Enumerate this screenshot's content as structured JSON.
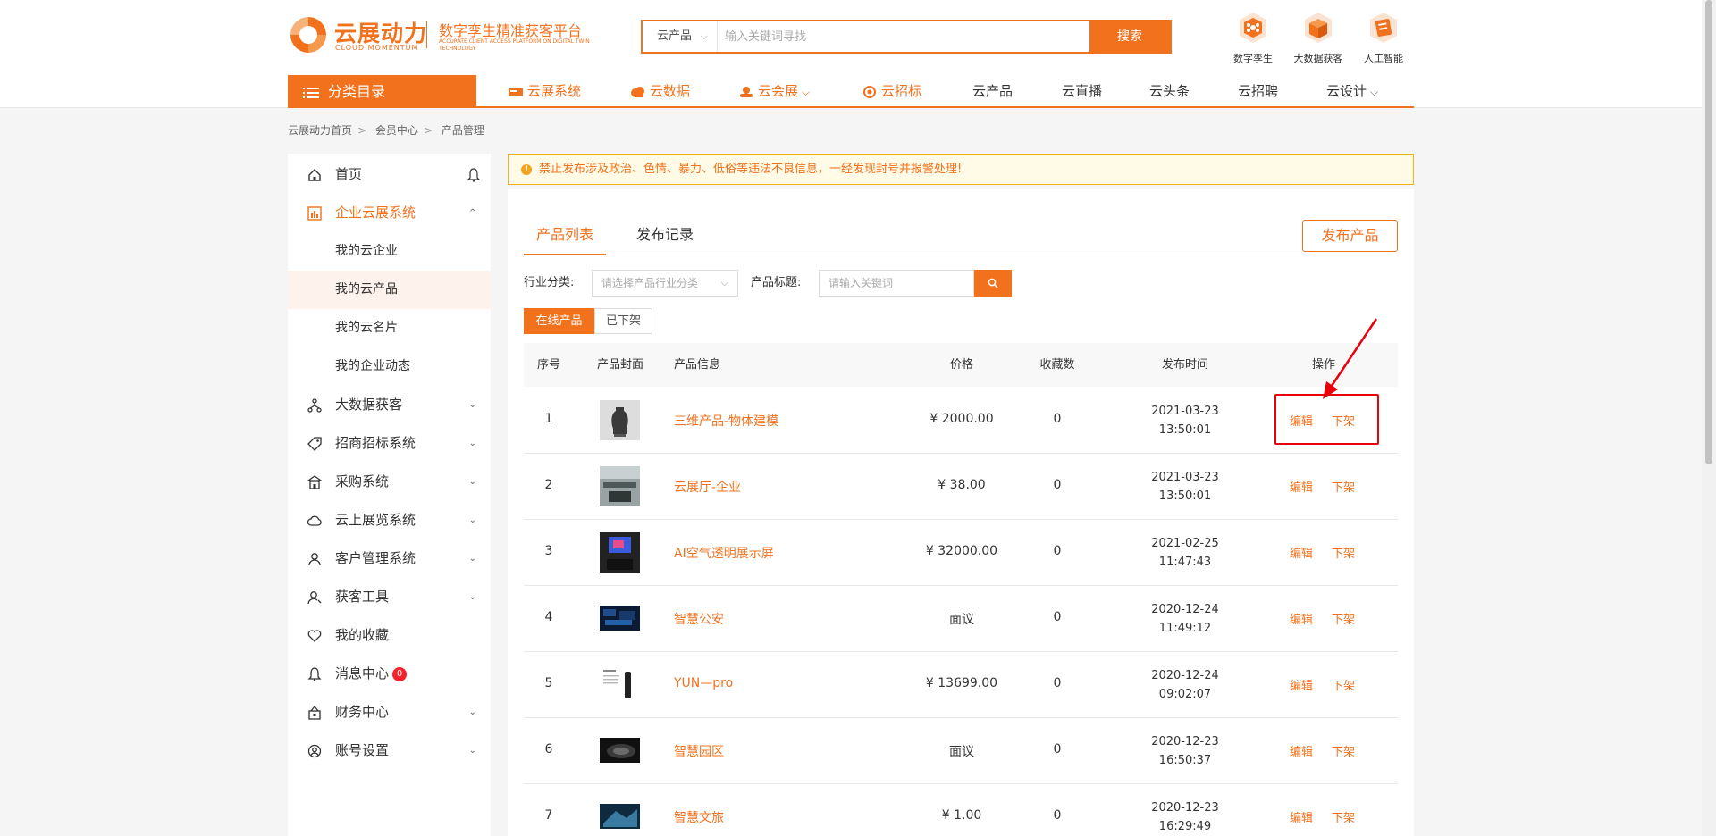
{
  "brand": {
    "name": "云展动力",
    "name_en": "CLOUD MOMENTUM",
    "slogan": "数字孪生精准获客平台",
    "slogan_en": "ACCURATE CLIENT ACCESS PLATFORM ON DIGITAL TWIN TECHNOLOGY",
    "color": "#f2711c"
  },
  "search": {
    "category": "云产品",
    "placeholder": "输入关键词寻找",
    "button": "搜索"
  },
  "quick_links": [
    {
      "label": "数字孪生",
      "icon": "digital-twin-icon"
    },
    {
      "label": "大数据获客",
      "icon": "big-data-icon"
    },
    {
      "label": "人工智能",
      "icon": "ai-icon"
    }
  ],
  "nav": {
    "category_label": "分类目录",
    "items": [
      {
        "label": "云展系统",
        "icon": "exhibition-icon"
      },
      {
        "label": "云数据",
        "icon": "cloud-data-icon"
      },
      {
        "label": "云会展",
        "icon": "convention-icon"
      },
      {
        "label": "云招标",
        "icon": "tender-icon"
      },
      {
        "label": "云产品"
      },
      {
        "label": "云直播"
      },
      {
        "label": "云头条"
      },
      {
        "label": "云招聘"
      },
      {
        "label": "云设计"
      }
    ]
  },
  "breadcrumb": [
    "云展动力首页",
    "会员中心",
    "产品管理"
  ],
  "sidebar": {
    "items": [
      {
        "label": "首页",
        "icon": "home-icon"
      },
      {
        "label": "企业云展系统",
        "icon": "enterprise-icon"
      },
      {
        "label": "大数据获客",
        "icon": "network-icon"
      },
      {
        "label": "招商招标系统",
        "icon": "tag-icon"
      },
      {
        "label": "采购系统",
        "icon": "store-icon"
      },
      {
        "label": "云上展览系统",
        "icon": "cloud-icon"
      },
      {
        "label": "客户管理系统",
        "icon": "user-icon"
      },
      {
        "label": "获客工具",
        "icon": "user-tool-icon"
      },
      {
        "label": "我的收藏",
        "icon": "heart-icon"
      },
      {
        "label": "消息中心",
        "icon": "bell-icon",
        "badge": "0"
      },
      {
        "label": "财务中心",
        "icon": "finance-icon"
      },
      {
        "label": "账号设置",
        "icon": "account-icon"
      }
    ],
    "sub_items": [
      "我的云企业",
      "我的云产品",
      "我的云名片",
      "我的企业动态"
    ]
  },
  "notice": "禁止发布涉及政治、色情、暴力、低俗等违法不良信息，一经发现封号并报警处理!",
  "tabs": [
    "产品列表",
    "发布记录"
  ],
  "publish_button": "发布产品",
  "filters": {
    "industry_label": "行业分类:",
    "industry_placeholder": "请选择产品行业分类",
    "title_label": "产品标题:",
    "title_placeholder": "请输入关键词"
  },
  "status_toggle": [
    "在线产品",
    "已下架"
  ],
  "table": {
    "headers": [
      "序号",
      "产品封面",
      "产品信息",
      "价格",
      "收藏数",
      "发布时间",
      "操作"
    ],
    "rows": [
      {
        "no": "1",
        "name": "三维产品-物体建模",
        "price": "¥ 2000.00",
        "fav": "0",
        "date": "2021-03-23",
        "time": "13:50:01",
        "edit": "编辑",
        "off": "下架"
      },
      {
        "no": "2",
        "name": "云展厅-企业",
        "price": "¥ 38.00",
        "fav": "0",
        "date": "2021-03-23",
        "time": "13:50:01",
        "edit": "编辑",
        "off": "下架"
      },
      {
        "no": "3",
        "name": "AI空气透明展示屏",
        "price": "¥ 32000.00",
        "fav": "0",
        "date": "2021-02-25",
        "time": "11:47:43",
        "edit": "编辑",
        "off": "下架"
      },
      {
        "no": "4",
        "name": "智慧公安",
        "price": "面议",
        "fav": "0",
        "date": "2020-12-24",
        "time": "11:49:12",
        "edit": "编辑",
        "off": "下架"
      },
      {
        "no": "5",
        "name": "YUN—pro",
        "price": "¥ 13699.00",
        "fav": "0",
        "date": "2020-12-24",
        "time": "09:02:07",
        "edit": "编辑",
        "off": "下架"
      },
      {
        "no": "6",
        "name": "智慧园区",
        "price": "面议",
        "fav": "0",
        "date": "2020-12-23",
        "time": "16:50:37",
        "edit": "编辑",
        "off": "下架"
      },
      {
        "no": "7",
        "name": "智慧文旅",
        "price": "¥ 1.00",
        "fav": "0",
        "date": "2020-12-23",
        "time": "16:29:49",
        "edit": "编辑",
        "off": "下架"
      }
    ]
  }
}
